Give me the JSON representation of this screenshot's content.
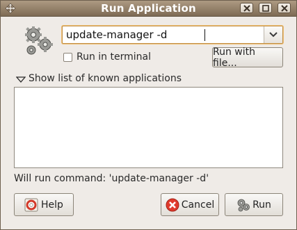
{
  "window": {
    "title": "Run Application"
  },
  "command": {
    "value": "update-manager -d"
  },
  "options": {
    "run_in_terminal_label": "Run in terminal",
    "run_in_terminal_checked": false,
    "run_with_file_label": "Run with file..."
  },
  "known_apps": {
    "expander_label": "Show list of known applications",
    "expanded": true,
    "items": []
  },
  "status": {
    "will_run": "Will run command: 'update-manager -d'"
  },
  "buttons": {
    "help": "Help",
    "cancel": "Cancel",
    "run": "Run"
  },
  "icons": {
    "app_icon": "gears-icon",
    "help_icon": "lifebuoy-icon",
    "cancel_icon": "red-x-icon",
    "run_icon": "gears-icon"
  },
  "colors": {
    "titlebar": "#8f7b63",
    "window_bg": "#efebe7",
    "focus_ring": "#f0c279",
    "cancel_red": "#e03a2c"
  }
}
